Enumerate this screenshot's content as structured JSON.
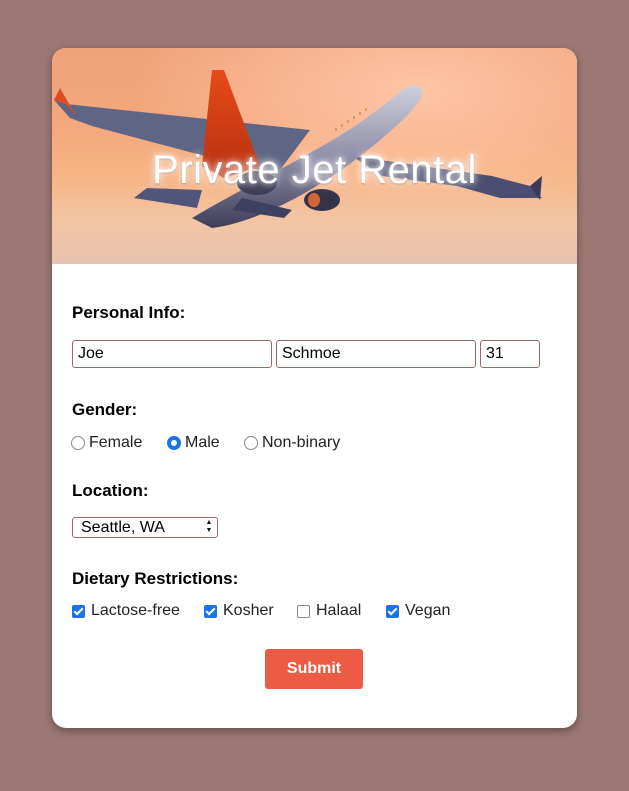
{
  "header": {
    "title": "Private Jet Rental"
  },
  "personal": {
    "label": "Personal Info:",
    "first_name": "Joe",
    "last_name": "Schmoe",
    "age": "31"
  },
  "gender": {
    "label": "Gender:",
    "options": [
      {
        "label": "Female",
        "selected": false
      },
      {
        "label": "Male",
        "selected": true
      },
      {
        "label": "Non-binary",
        "selected": false
      }
    ]
  },
  "location": {
    "label": "Location:",
    "selected": "Seattle, WA"
  },
  "diet": {
    "label": "Dietary Restrictions:",
    "options": [
      {
        "label": "Lactose-free",
        "checked": true
      },
      {
        "label": "Kosher",
        "checked": true
      },
      {
        "label": "Halaal",
        "checked": false
      },
      {
        "label": "Vegan",
        "checked": true
      }
    ]
  },
  "submit_label": "Submit",
  "colors": {
    "page_background": "#9c7773",
    "accent": "#1a73e8",
    "submit": "#ed5b44"
  }
}
